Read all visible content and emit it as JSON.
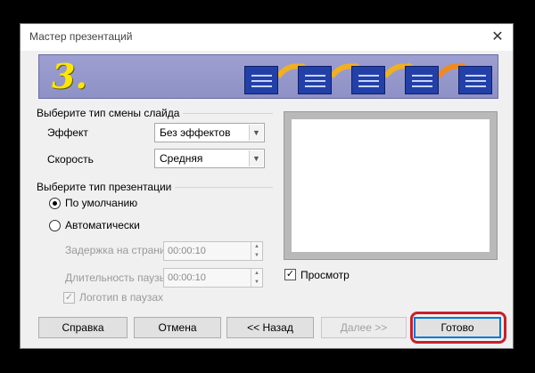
{
  "window": {
    "title": "Мастер презентаций",
    "close_glyph": "✕"
  },
  "banner": {
    "step": "3."
  },
  "transition": {
    "group_title": "Выберите тип смены слайда",
    "effect_label": "Эффект",
    "effect_value": "Без эффектов",
    "speed_label": "Скорость",
    "speed_value": "Средняя"
  },
  "presentation_type": {
    "group_title": "Выберите тип презентации",
    "default_label": "По умолчанию",
    "auto_label": "Автоматически",
    "page_delay_label": "Задержка на страни",
    "page_delay_value": "00:00:10",
    "pause_duration_label": "Длительность паузы",
    "pause_duration_value": "00:00:10",
    "logo_label": "Логотип в паузах",
    "selected": "default"
  },
  "preview": {
    "checkbox_label": "Просмотр",
    "checked": true
  },
  "buttons": {
    "help": "Справка",
    "cancel": "Отмена",
    "back": "<< Назад",
    "next": "Далее >>",
    "finish": "Готово"
  },
  "colors": {
    "banner": "#9d9fd0",
    "step_number": "#ffe600",
    "slide_icon": "#2240a8",
    "arrow": "#f0b020",
    "highlight": "#c8202a"
  }
}
